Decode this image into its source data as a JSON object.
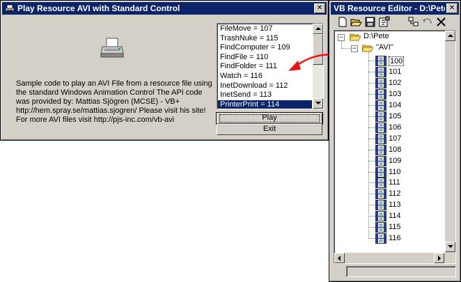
{
  "main_window": {
    "title": "Play Resource AVI with Standard Control",
    "description": "Sample code to play an AVI File from a resource file using the standard Windows Animation Control The API code was provided by: Mattias Sjögren (MCSE) - VB+ http://hem.spray.se/mattias.sjogren/ Please visit his site! For more AVI files visit http://pjs-inc.com/vb-avi",
    "list_items": [
      "FileMove = 107",
      "TrashNuke = 115",
      "FindComputer = 109",
      "FindFile = 110",
      "FindFolder = 111",
      "Watch = 116",
      "InetDownload = 112",
      "InetSend = 113",
      "PrinterPrint = 114"
    ],
    "selected_item": "PrinterPrint = 114",
    "play_label": "Play",
    "exit_label": "Exit",
    "close_glyph": "✕"
  },
  "editor_window": {
    "title": "VB Resource Editor - D:\\Pete...",
    "close_glyph": "✕",
    "toolbar": [
      "new-icon",
      "open-icon",
      "save-icon",
      "properties-icon",
      "tree-view-icon",
      "undo-icon",
      "delete-icon"
    ],
    "root_label": "D:\\Pete",
    "folder_label": "\"AVI\"",
    "resource_ids": [
      "100",
      "101",
      "102",
      "103",
      "104",
      "105",
      "106",
      "107",
      "108",
      "109",
      "110",
      "111",
      "112",
      "113",
      "114",
      "115",
      "116"
    ],
    "selected_id": "100"
  },
  "annotation": {
    "arrow_color": "#ee1111"
  },
  "colors": {
    "title_bar": "#0a246a",
    "selection": "#0a246a",
    "face": "#d4d0c8"
  }
}
